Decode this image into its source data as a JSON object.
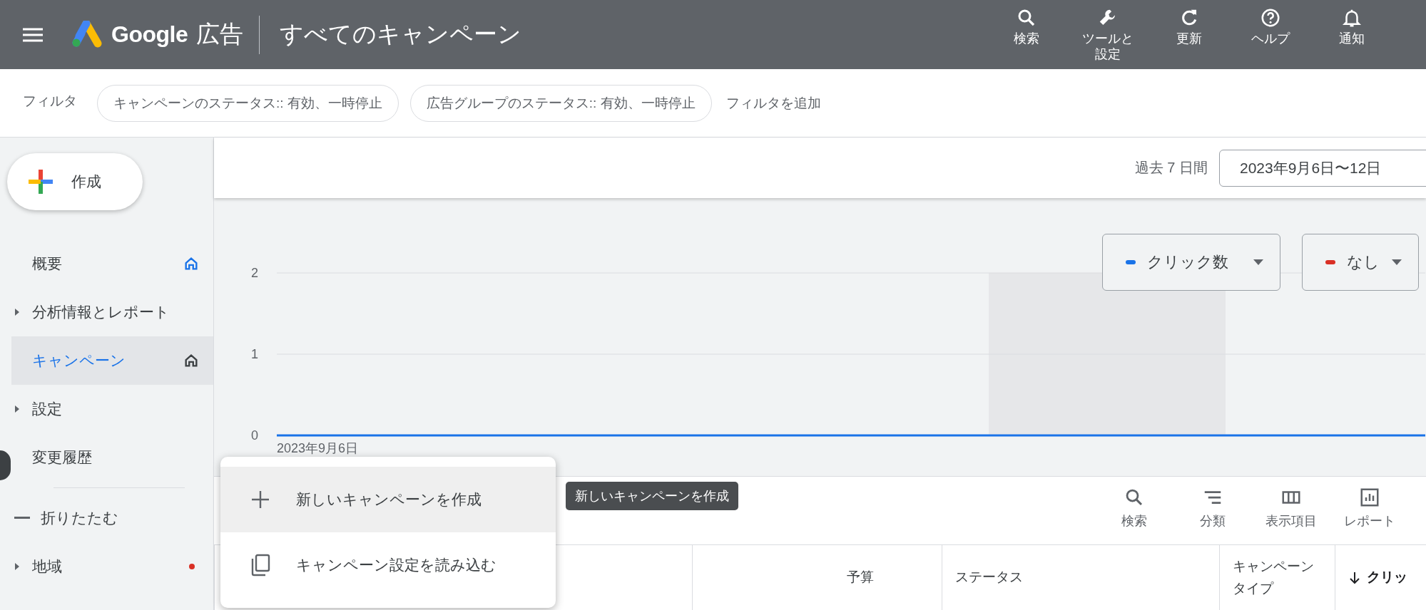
{
  "header": {
    "brand": "Google",
    "product": "広告",
    "title": "すべてのキャンペーン",
    "actions": [
      {
        "label": "検索",
        "kind": "search"
      },
      {
        "label": "ツールと設定",
        "kind": "tools"
      },
      {
        "label": "更新",
        "kind": "refresh"
      },
      {
        "label": "ヘルプ",
        "kind": "help"
      },
      {
        "label": "通知",
        "kind": "bell"
      }
    ]
  },
  "filters": {
    "label": "フィルタ",
    "chips": [
      "キャンペーンのステータス:: 有効、一時停止",
      "広告グループのステータス:: 有効、一時停止"
    ],
    "add": "フィルタを追加"
  },
  "sidebar": {
    "create": "作成",
    "items": [
      {
        "label": "概要",
        "kind": "home",
        "selected": false
      },
      {
        "label": "分析情報とレポート",
        "kind": "group",
        "selected": false
      },
      {
        "label": "キャンペーン",
        "kind": "home",
        "selected": true
      },
      {
        "label": "設定",
        "kind": "group",
        "selected": false
      },
      {
        "label": "変更履歴",
        "kind": "plain",
        "selected": false
      },
      {
        "label": "折りたたむ",
        "kind": "collapse",
        "selected": false
      },
      {
        "label": "地域",
        "kind": "group",
        "selected": false,
        "alert": true
      }
    ]
  },
  "date_range": {
    "preset": "過去 7 日間",
    "value": "2023年9月6日〜12日"
  },
  "chart": {
    "metrics": [
      {
        "label": "クリック数",
        "color": "#1a73e8"
      },
      {
        "label": "なし",
        "color": "#d93025"
      }
    ],
    "start_date": "2023年9月6日",
    "chart_data": {
      "type": "line",
      "ylim": [
        0,
        2
      ],
      "yticks": [
        {
          "value": 0,
          "label": "0"
        },
        {
          "value": 1,
          "label": "1"
        },
        {
          "value": 2,
          "label": "2"
        }
      ],
      "series": [
        {
          "color": "#1a73e8",
          "values": [
            0,
            0,
            0,
            0,
            0,
            0,
            0
          ]
        }
      ]
    }
  },
  "toolbar": {
    "tooltip": "新しいキャンペーンを作成",
    "tools": [
      {
        "label": "検索",
        "kind": "search"
      },
      {
        "label": "分類",
        "kind": "segment"
      },
      {
        "label": "表示項目",
        "kind": "columns"
      },
      {
        "label": "レポート",
        "kind": "reports"
      }
    ]
  },
  "table": {
    "columns": [
      {
        "label": "予算",
        "kind": "number",
        "sorted": false
      },
      {
        "label": "ステータス",
        "kind": "text",
        "sorted": false
      },
      {
        "label": "キャンペーンタイプ",
        "kind": "text",
        "sorted": false
      },
      {
        "label": "クリッ",
        "kind": "number",
        "sorted": true
      }
    ]
  },
  "create_menu": {
    "items": [
      {
        "label": "新しいキャンペーンを作成",
        "kind": "new",
        "highlighted": true
      },
      {
        "label": "キャンペーン設定を読み込む",
        "kind": "load",
        "highlighted": false
      }
    ]
  }
}
